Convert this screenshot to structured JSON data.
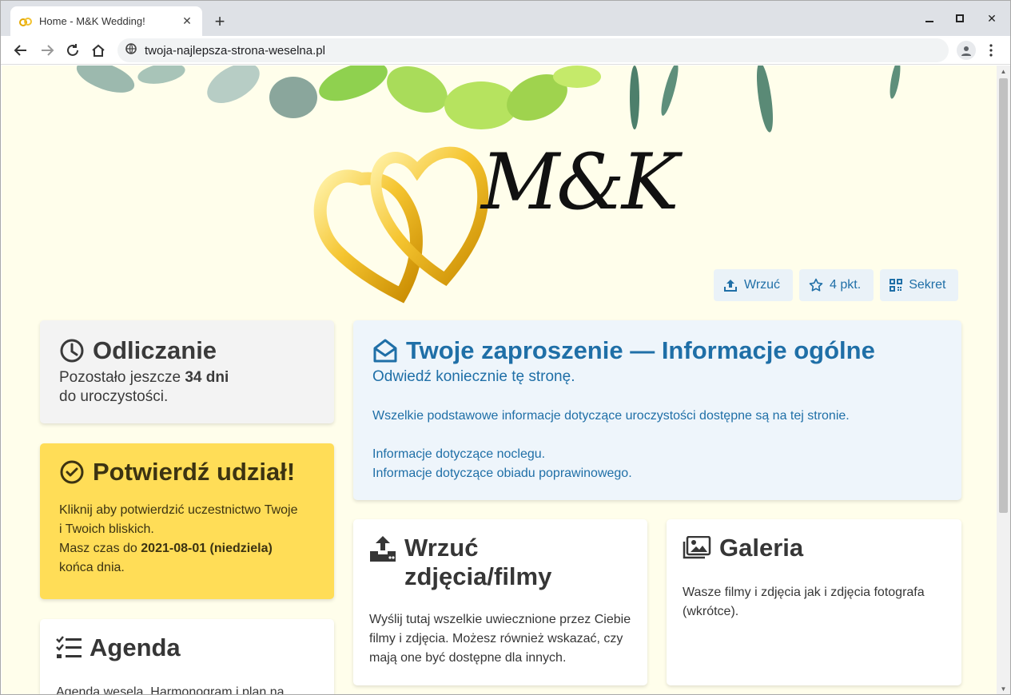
{
  "browser": {
    "tab_title": "Home - M&K Wedding!",
    "new_tab": "+",
    "url": "twoja-najlepsza-strona-weselna.pl"
  },
  "header": {
    "monogram": "M&K"
  },
  "actions": {
    "upload_label": "Wrzuć",
    "points_label": "4 pkt.",
    "secret_label": "Sekret"
  },
  "countdown": {
    "title": "Odliczanie",
    "line1_prefix": "Pozostało jeszcze ",
    "days": "34 dni",
    "line2": "do uroczystości."
  },
  "confirm": {
    "title": "Potwierdź udział!",
    "line1": "Kliknij aby potwierdzić uczestnictwo Twoje",
    "line2": "i Twoich bliskich.",
    "line3_prefix": "Masz czas do ",
    "deadline": "2021-08-01 (niedziela)",
    "line4": "końca dnia."
  },
  "agenda": {
    "title": "Agenda",
    "desc": "Agenda wesela. Harmonogram i plan na"
  },
  "invite": {
    "title": "Twoje zaproszenie — Informacje ogólne",
    "subtitle": "Odwiedź koniecznie tę stronę.",
    "line1": "Wszelkie podstawowe informacje dotyczące uroczystości dostępne są na tej stronie.",
    "line2": "Informacje dotyczące noclegu.",
    "line3": "Informacje dotyczące obiadu poprawinowego."
  },
  "upload": {
    "title_line1": "Wrzuć",
    "title_line2": "zdjęcia/filmy",
    "desc": "Wyślij tutaj wszelkie uwiecznione przez Ciebie filmy i zdjęcia. Możesz również wskazać, czy mają one być dostępne dla innych."
  },
  "gallery": {
    "title": "Galeria",
    "desc": "Wasze filmy i zdjęcia jak i zdjęcia fotografa (wkrótce)."
  },
  "colors": {
    "page_bg": "#fffeeb",
    "accent_blue": "#1f6fa7",
    "confirm_yellow": "#ffdd57",
    "invite_bg": "#eef5fb"
  }
}
